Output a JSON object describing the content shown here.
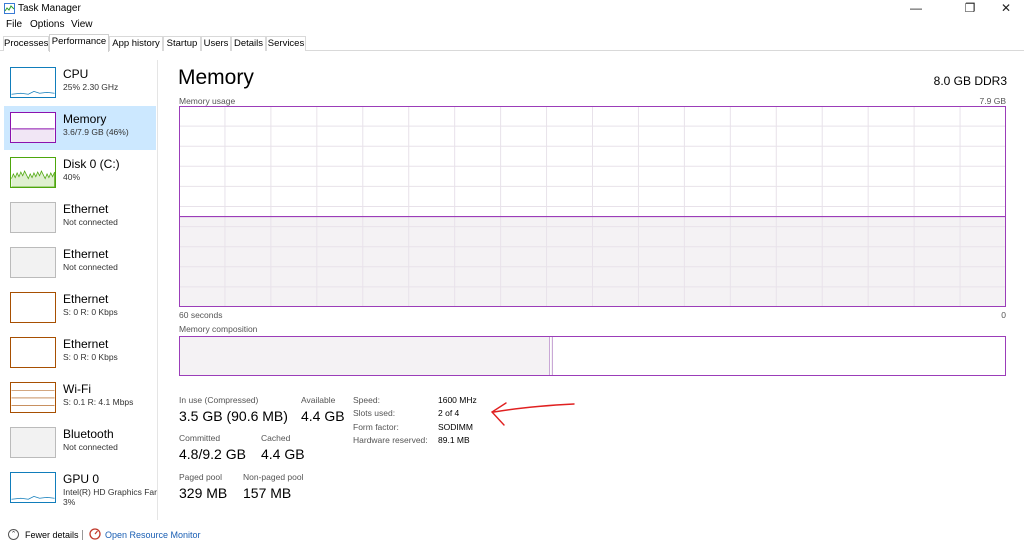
{
  "window": {
    "title": "Task Manager",
    "minimize_glyph": "—",
    "maximize_glyph": "❐",
    "close_glyph": "✕"
  },
  "menu": [
    "File",
    "Options",
    "View"
  ],
  "tabs": [
    "Processes",
    "Performance",
    "App history",
    "Startup",
    "Users",
    "Details",
    "Services"
  ],
  "active_tab": "Performance",
  "sidebar": [
    {
      "name": "CPU",
      "sub": "25% 2.30 GHz",
      "sub2": "",
      "icon": "cpu-graph-icon",
      "color": "#117dbb"
    },
    {
      "name": "Memory",
      "sub": "3.6/7.9 GB (46%)",
      "sub2": "",
      "icon": "memory-graph-icon",
      "color": "#8b12ae",
      "selected": true
    },
    {
      "name": "Disk 0 (C:)",
      "sub": "40%",
      "sub2": "",
      "icon": "disk-graph-icon",
      "color": "#4da60c"
    },
    {
      "name": "Ethernet",
      "sub": "Not connected",
      "sub2": "",
      "icon": "ethernet-graph-icon",
      "color": "#bbbbbb"
    },
    {
      "name": "Ethernet",
      "sub": "Not connected",
      "sub2": "",
      "icon": "ethernet-graph-icon",
      "color": "#bbbbbb"
    },
    {
      "name": "Ethernet",
      "sub": "S: 0 R: 0 Kbps",
      "sub2": "",
      "icon": "ethernet-graph-icon",
      "color": "#a74f01"
    },
    {
      "name": "Ethernet",
      "sub": "S: 0 R: 0 Kbps",
      "sub2": "",
      "icon": "ethernet-graph-icon",
      "color": "#a74f01"
    },
    {
      "name": "Wi-Fi",
      "sub": "S: 0.1 R: 4.1 Mbps",
      "sub2": "",
      "icon": "wifi-graph-icon",
      "color": "#a74f01"
    },
    {
      "name": "Bluetooth",
      "sub": "Not connected",
      "sub2": "",
      "icon": "bluetooth-graph-icon",
      "color": "#bbbbbb"
    },
    {
      "name": "GPU 0",
      "sub": "Intel(R) HD Graphics Far",
      "sub2": "3%",
      "icon": "gpu-graph-icon",
      "color": "#117dbb"
    }
  ],
  "main": {
    "title": "Memory",
    "total": "8.0 GB DDR3",
    "usage_label": "Memory usage",
    "usage_max": "7.9 GB",
    "time_label": "60 seconds",
    "time_zero": "0",
    "composition_label": "Memory composition",
    "accent_color": "#9b3db9",
    "usage_fraction": 0.45,
    "composition_inuse_fraction": 0.448
  },
  "stats": {
    "in_use_label": "In use (Compressed)",
    "in_use_value": "3.5 GB (90.6 MB)",
    "available_label": "Available",
    "available_value": "4.4 GB",
    "committed_label": "Committed",
    "committed_value": "4.8/9.2 GB",
    "cached_label": "Cached",
    "cached_value": "4.4 GB",
    "paged_label": "Paged pool",
    "paged_value": "329 MB",
    "nonpaged_label": "Non-paged pool",
    "nonpaged_value": "157 MB"
  },
  "details": [
    {
      "label": "Speed:",
      "value": "1600 MHz"
    },
    {
      "label": "Slots used:",
      "value": "2 of 4"
    },
    {
      "label": "Form factor:",
      "value": "SODIMM"
    },
    {
      "label": "Hardware reserved:",
      "value": "89.1 MB"
    }
  ],
  "annotation_color": "#e02020",
  "footer": {
    "fewer_details": "Fewer details",
    "open_resource_monitor": "Open Resource Monitor"
  }
}
